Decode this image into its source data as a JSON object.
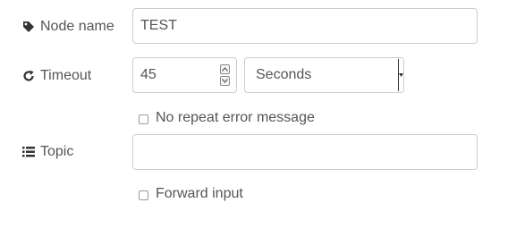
{
  "fields": {
    "name": {
      "label": "Node name",
      "value": "TEST",
      "icon": "tag-icon"
    },
    "timeout": {
      "label": "Timeout",
      "value": "45",
      "unit": "Seconds",
      "icon": "refresh-icon"
    },
    "topic": {
      "label": "Topic",
      "value": "",
      "icon": "list-icon"
    }
  },
  "options": {
    "no_repeat_error": {
      "label": "No repeat error message",
      "checked": false
    },
    "forward_input": {
      "label": "Forward input",
      "checked": false
    }
  }
}
